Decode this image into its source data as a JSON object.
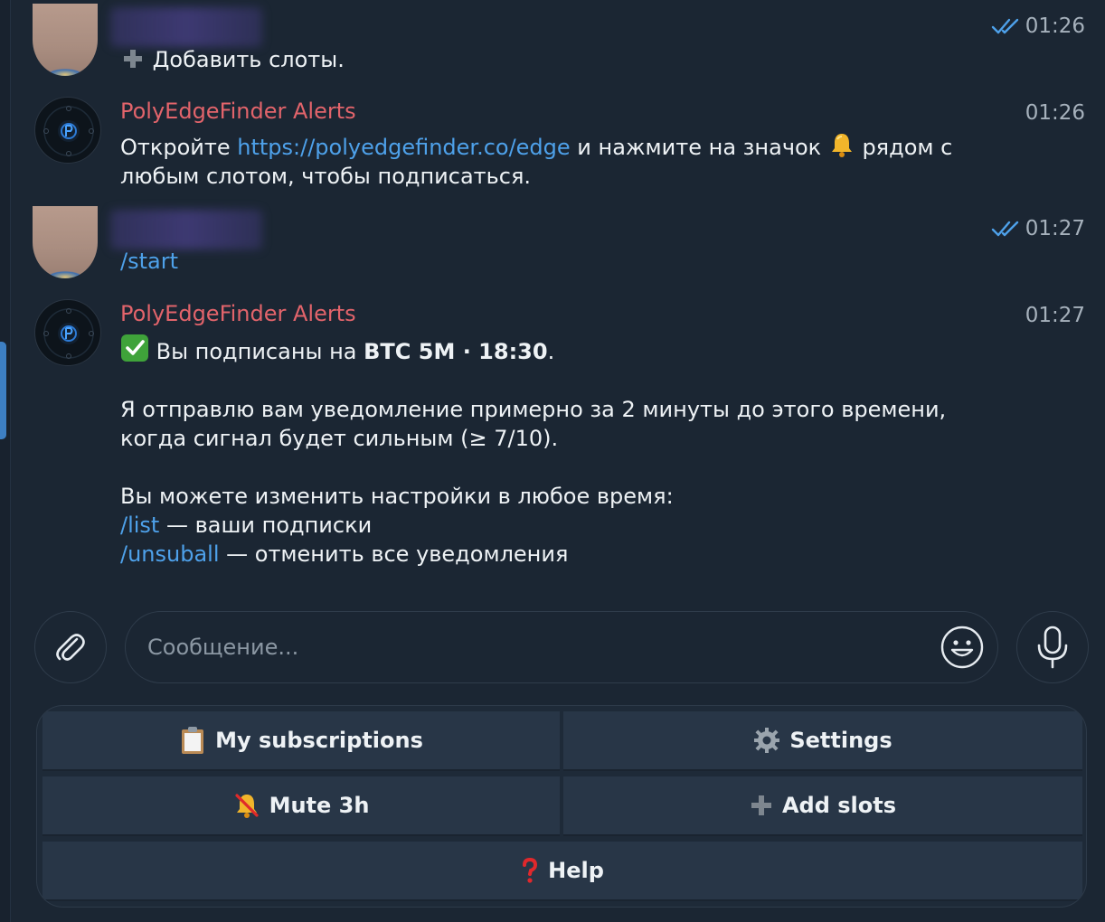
{
  "messages": [
    {
      "id": "m1",
      "from": "user",
      "time": "01:26",
      "text": "Добавить слоты."
    },
    {
      "id": "m2",
      "from": "bot",
      "sender": "PolyEdgeFinder Alerts",
      "time": "01:26",
      "line1_pre": "Откройте ",
      "line1_link": "https://polyedgefinder.co/edge",
      "line1_post": " и нажмите на значок",
      "line1_tail": " рядом с",
      "line2": "любым слотом, чтобы подписаться."
    },
    {
      "id": "m3",
      "from": "user",
      "time": "01:27",
      "command": "/start"
    },
    {
      "id": "m4",
      "from": "bot",
      "sender": "PolyEdgeFinder Alerts",
      "time": "01:27",
      "line1_pre": " Вы подписаны на ",
      "line1_bold": "BTC 5M · 18:30",
      "line1_post": ".",
      "para2_l1": "Я отправлю вам уведомление примерно за 2 минуты до этого времени,",
      "para2_l2": "когда сигнал будет сильным (≥ 7/10).",
      "para3_l1": "Вы можете изменить настройки в любое время:",
      "cmd1": "/list",
      "cmd1_desc": " — ваши подписки",
      "cmd2": "/unsuball",
      "cmd2_desc": " — отменить все уведомления"
    }
  ],
  "composer": {
    "placeholder": "Сообщение..."
  },
  "keyboard": {
    "buttons": [
      {
        "label": "My subscriptions",
        "icon": "clipboard-icon"
      },
      {
        "label": "Settings",
        "icon": "gear-icon"
      },
      {
        "label": "Mute 3h",
        "icon": "muted-bell-icon"
      },
      {
        "label": "Add slots",
        "icon": "plus-icon"
      },
      {
        "label": "Help",
        "icon": "question-icon"
      }
    ]
  },
  "colors": {
    "background": "#1b2633",
    "sender_name": "#e2646b",
    "link": "#4ea1ea",
    "read_checks": "#4ea1ea",
    "keyboard_button": "#283647"
  }
}
